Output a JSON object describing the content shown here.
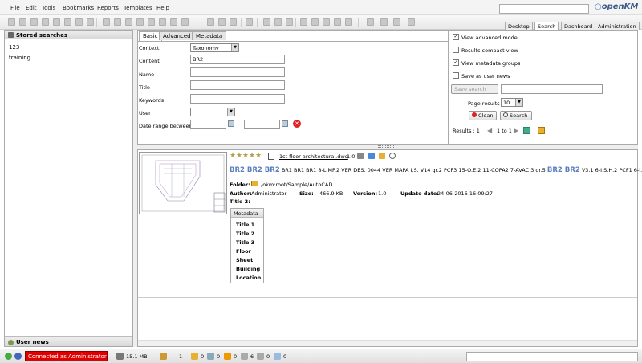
{
  "menu": [
    "File",
    "Edit",
    "Tools",
    "Bookmarks",
    "Reports",
    "Templates",
    "Help"
  ],
  "logo": {
    "prefix": "open",
    "suffix": "KM"
  },
  "right_tabs": [
    "Desktop",
    "Search",
    "Dashboard",
    "Administration"
  ],
  "left": {
    "stored_searches_title": "Stored searches",
    "items": [
      "123",
      "training"
    ],
    "user_news_title": "User news"
  },
  "search_tabs": [
    "Basic",
    "Advanced",
    "Metadata"
  ],
  "form": {
    "context_label": "Context",
    "context_value": "Taxonomy",
    "content_label": "Content",
    "content_value": "BR2",
    "name_label": "Name",
    "title_label": "Title",
    "keywords_label": "Keywords",
    "user_label": "User",
    "date_label": "Date range between",
    "date_sep": "—"
  },
  "options": {
    "view_advanced": "View advanced mode",
    "results_compact": "Results compact view",
    "view_metadata": "View metadata groups",
    "save_user_news": "Save as user news",
    "save_search": "Save search",
    "page_results_label": "Page results",
    "page_results_value": "10",
    "clean": "Clean",
    "search": "Search",
    "results_label": "Results : 1",
    "pager": "1 to 1"
  },
  "result": {
    "filename": "1st floor architectural.dwg",
    "version_short": "1.0",
    "keywords_hl": "BR2 BR2 BR2",
    "keywords_mid": "BR1 BR1 BR1 8-LIMP.2 VER DES. 0044 VER MAPA I.S. V14 gr.2 PCF3 15-O.E.2 11-COPA2 7-AVAC 3 gr.5",
    "keywords_hl2": "BR2 BR2",
    "keywords_tail": "V3.1 6-I.S.H.2 PCF1 6-I.S.D.2 CE",
    "folder_label": "Folder:",
    "folder_value": "/okm:root/Sample/AutoCAD",
    "author_label": "Author:",
    "author_value": "Administrator",
    "size_label": "Size:",
    "size_value": "466.9 KB",
    "version_label": "Version:",
    "version_value": "1.0",
    "update_label": "Update date:",
    "update_value": "24-06-2016 16:09:27",
    "title2_label": "Title 2:",
    "metadata_tab": "Metadata",
    "metadata_rows": [
      "Title 1",
      "Title 2",
      "Title 3",
      "Floor",
      "Sheet",
      "Building",
      "Location"
    ]
  },
  "status": {
    "connected": "Connected as Administrator",
    "disk": "15.1 MB",
    "users": "1",
    "c1": "0",
    "c2": "0",
    "c3": "0",
    "c4": "6",
    "c5": "0",
    "c6": "0"
  }
}
